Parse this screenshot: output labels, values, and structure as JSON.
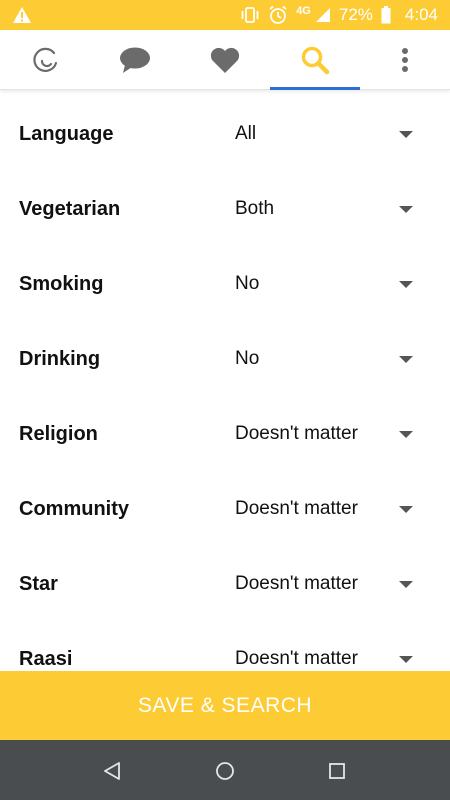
{
  "status_bar": {
    "network": "4G",
    "battery": "72%",
    "time": "4:04",
    "icons": [
      "warning-icon",
      "vibrate-icon",
      "alarm-icon",
      "signal-icon",
      "battery-icon"
    ]
  },
  "tabs": [
    {
      "name": "logo",
      "icon": "app-logo-icon"
    },
    {
      "name": "messages",
      "icon": "chat-bubble-icon"
    },
    {
      "name": "favorites",
      "icon": "heart-icon"
    },
    {
      "name": "search",
      "icon": "search-icon",
      "active": true
    },
    {
      "name": "more",
      "icon": "more-vert-icon"
    }
  ],
  "filters": [
    {
      "label": "Language",
      "value": "All"
    },
    {
      "label": "Vegetarian",
      "value": "Both"
    },
    {
      "label": "Smoking",
      "value": "No"
    },
    {
      "label": "Drinking",
      "value": "No"
    },
    {
      "label": "Religion",
      "value": "Doesn't matter"
    },
    {
      "label": "Community",
      "value": "Doesn't matter"
    },
    {
      "label": "Star",
      "value": "Doesn't matter"
    },
    {
      "label": "Raasi",
      "value": "Doesn't matter"
    }
  ],
  "save_button": {
    "label": "SAVE & SEARCH"
  },
  "colors": {
    "accent": "#fdcb33",
    "active_tab": "#2b6fd6",
    "icon_gray": "#6b6b6b",
    "nav_bar": "#4a4d50"
  }
}
